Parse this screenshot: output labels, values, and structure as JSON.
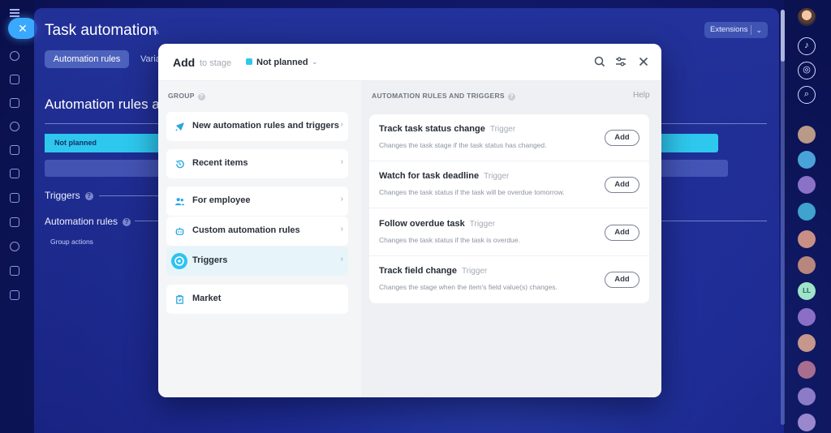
{
  "app": {
    "title": "Task automation",
    "extensions_label": "Extensions",
    "tabs": [
      "Automation rules",
      "Varia"
    ],
    "heading": "Automation rules a",
    "stage_bar_label": "Not planned",
    "triggers_label": "Triggers",
    "automation_rules_label": "Automation rules",
    "group_actions_label": "Group actions",
    "rail_initials": "LL"
  },
  "modal": {
    "add_label": "Add",
    "to_stage_label": "to stage",
    "stage_name": "Not planned",
    "stage_color": "#2ec8ee",
    "group_header": "GROUP",
    "rules_header": "AUTOMATION RULES AND TRIGGERS",
    "help_label": "Help",
    "groups": [
      {
        "label": "New automation rules and triggers",
        "icon": "rocket-icon"
      },
      {
        "label": "Recent items",
        "icon": "history-icon"
      },
      {
        "label": "For employee",
        "icon": "people-icon"
      },
      {
        "label": "Custom automation rules",
        "icon": "robot-icon"
      },
      {
        "label": "Triggers",
        "icon": "triggers-icon",
        "active": true
      },
      {
        "label": "Market",
        "icon": "market-icon"
      }
    ],
    "rules": [
      {
        "title": "Track task status change",
        "tag": "Trigger",
        "desc": "Changes the task stage if the task status has changed.",
        "button": "Add"
      },
      {
        "title": "Watch for task deadline",
        "tag": "Trigger",
        "desc": "Changes the task status if the task will be overdue tomorrow.",
        "button": "Add"
      },
      {
        "title": "Follow overdue task",
        "tag": "Trigger",
        "desc": "Changes the task status if the task is overdue.",
        "button": "Add"
      },
      {
        "title": "Track field change",
        "tag": "Trigger",
        "desc": "Changes the stage when the item's field value(s) changes.",
        "button": "Add"
      }
    ]
  },
  "colors": {
    "accent": "#2ec8ee",
    "close_pill": "#3aa8ff"
  }
}
